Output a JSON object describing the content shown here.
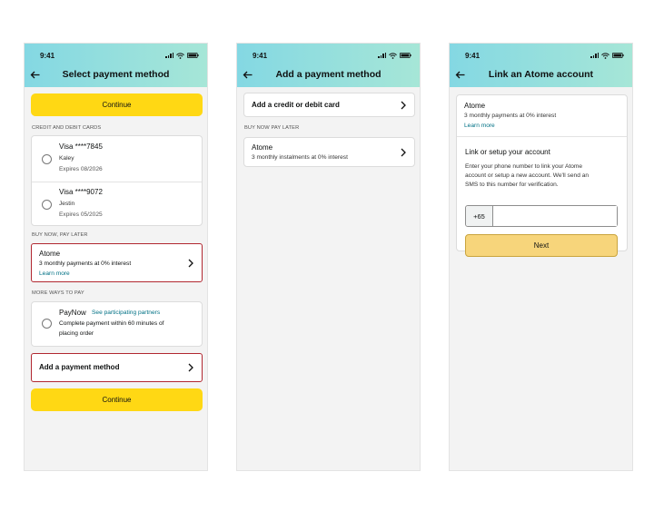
{
  "status_time": "9:41",
  "screen1": {
    "title": "Select payment method",
    "continue_label": "Continue",
    "credit_section": "CREDIT AND DEBIT CARDS",
    "cards": [
      {
        "label": "Visa ****7845",
        "name": "Kaley",
        "expires": "Expires 08/2026"
      },
      {
        "label": "Visa ****9072",
        "name": "Jestin",
        "expires": "Expires 05/2025"
      }
    ],
    "bnpl_section": "BUY NOW, PAY LATER",
    "atome": {
      "title": "Atome",
      "subtitle": "3 monthly payments at 0% interest",
      "link": "Learn more"
    },
    "more_section": "MORE WAYS TO PAY",
    "paynow": {
      "title": "PayNow",
      "link": "See participating partners",
      "line1": "Complete payment within 60 minutes of",
      "line2": "placing order"
    },
    "add_method": "Add a payment method",
    "continue_bottom": "Continue"
  },
  "screen2": {
    "title": "Add a payment method",
    "add_card": "Add a credit or debit card",
    "bnpl_section": "BUY NOW PAY LATER",
    "atome": {
      "title": "Atome",
      "subtitle": "3 monthly instalments at 0% interest"
    }
  },
  "screen3": {
    "title": "Link an Atome account",
    "atome": {
      "title": "Atome",
      "subtitle": "3 monthly payments at 0% interest",
      "link": "Learn more"
    },
    "heading": "Link or setup your account",
    "desc1": "Enter your phone number to link your Atome",
    "desc2": "account or setup a new account. We'll send an",
    "desc3": "SMS to this number for verification.",
    "country_code": "+65",
    "phone_value": "",
    "next_label": "Next"
  },
  "colors": {
    "accent": "#ffd814",
    "header_start": "#84d8e3",
    "header_end": "#a6e6d7",
    "highlight": "#b12730",
    "link": "#007185"
  },
  "icons": [
    "back-arrow-icon",
    "signal-icon",
    "wifi-icon",
    "battery-icon",
    "chevron-right-icon"
  ]
}
